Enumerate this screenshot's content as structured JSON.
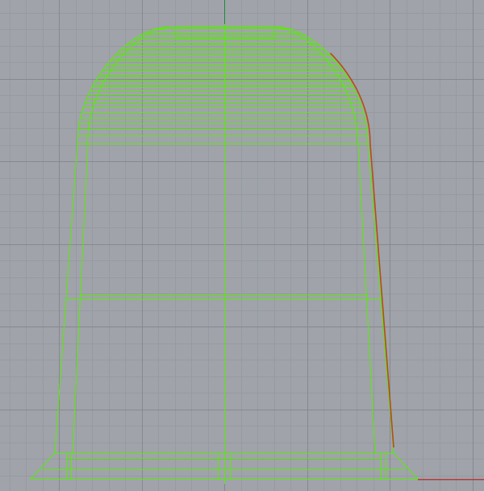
{
  "viewport": {
    "background": "#a0a3aa",
    "grid_minor_color": "#969aa1",
    "grid_major_color": "#86898f",
    "axis_y_color": "#1e8a3c",
    "axis_x_color": "#b23c3c",
    "wire_color": "#55ee00",
    "highlight_curve_color": "#b84a16",
    "show_grid": true,
    "selected_object": "wireframe-surface"
  }
}
